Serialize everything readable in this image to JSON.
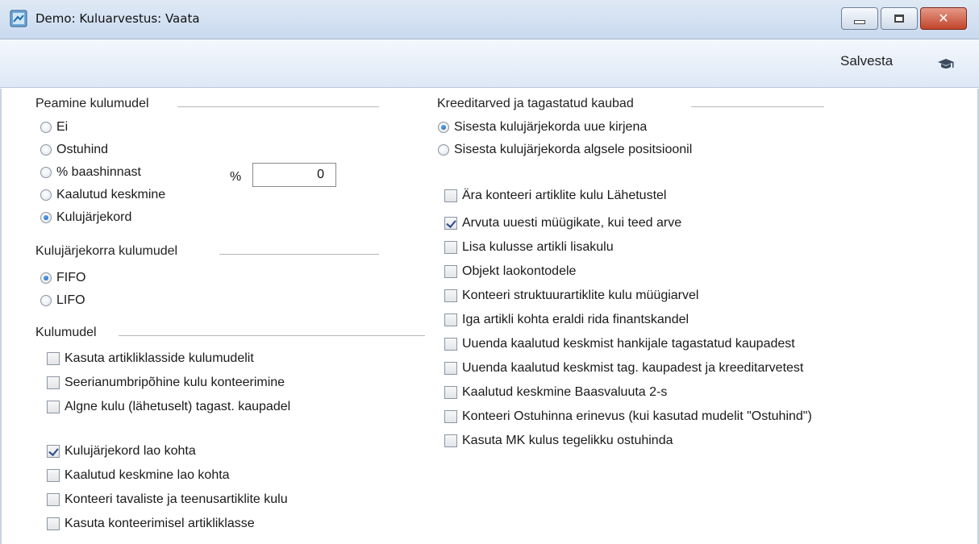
{
  "window": {
    "title": "Demo: Kuluarvestus: Vaata",
    "minimize_icon": "minimize-icon",
    "maximize_icon": "maximize-icon",
    "close_icon": "close-icon",
    "close_glyph": "✕"
  },
  "toolbar": {
    "save_label": "Salvesta",
    "help_icon": "graduation-cap-icon"
  },
  "main_cost_model": {
    "title": "Peamine kulumudel",
    "options": [
      {
        "label": "Ei",
        "selected": false
      },
      {
        "label": "Ostuhind",
        "selected": false
      },
      {
        "label": "% baashinnast",
        "selected": false
      },
      {
        "label": "Kaalutud keskmine",
        "selected": false
      },
      {
        "label": "Kulujärjekord",
        "selected": true
      }
    ],
    "percent_label": "%",
    "percent_value": "0"
  },
  "queue_cost_model": {
    "title": "Kulujärjekorra kulumudel",
    "options": [
      {
        "label": "FIFO",
        "selected": true
      },
      {
        "label": "LIFO",
        "selected": false
      }
    ]
  },
  "cost_model": {
    "title": "Kulumudel",
    "checks": [
      {
        "label": "Kasuta artikliklasside kulumudelit",
        "checked": false
      },
      {
        "label": "Seerianumbripõhine kulu konteerimine",
        "checked": false
      },
      {
        "label": "Algne kulu (lähetuselt) tagast. kaupadel",
        "checked": false
      }
    ],
    "checks2": [
      {
        "label": "Kulujärjekord lao kohta",
        "checked": true
      },
      {
        "label": "Kaalutud keskmine lao kohta",
        "checked": false
      },
      {
        "label": "Konteeri tavaliste ja teenusartiklite kulu",
        "checked": false
      },
      {
        "label": "Kasuta konteerimisel artikliklasse",
        "checked": false
      }
    ]
  },
  "credit_notes": {
    "title": "Kreeditarved ja tagastatud kaubad",
    "options": [
      {
        "label": "Sisesta kulujärjekorda uue kirjena",
        "selected": true
      },
      {
        "label": "Sisesta kulujärjekorda algsele positsioonil",
        "selected": false
      }
    ],
    "checks": [
      {
        "label": "Ära konteeri artiklite kulu Lähetustel",
        "checked": false
      },
      {
        "label": "Arvuta uuesti müügikate, kui teed arve",
        "checked": true
      },
      {
        "label": "Lisa kulusse artikli lisakulu",
        "checked": false
      },
      {
        "label": "Objekt laokontodele",
        "checked": false
      },
      {
        "label": "Konteeri struktuurartiklite kulu müügiarvel",
        "checked": false
      },
      {
        "label": "Iga artikli kohta eraldi rida finantskandel",
        "checked": false
      },
      {
        "label": "Uuenda kaalutud keskmist hankijale tagastatud kaupadest",
        "checked": false
      },
      {
        "label": "Uuenda kaalutud keskmist tag. kaupadest ja kreeditarvetest",
        "checked": false
      },
      {
        "label": "Kaalutud keskmine Baasvaluuta 2-s",
        "checked": false
      },
      {
        "label": "Konteeri Ostuhinna erinevus (kui kasutad mudelit \"Ostuhind\")",
        "checked": false
      },
      {
        "label": "Kasuta MK kulus tegelikku ostuhinda",
        "checked": false
      }
    ]
  }
}
